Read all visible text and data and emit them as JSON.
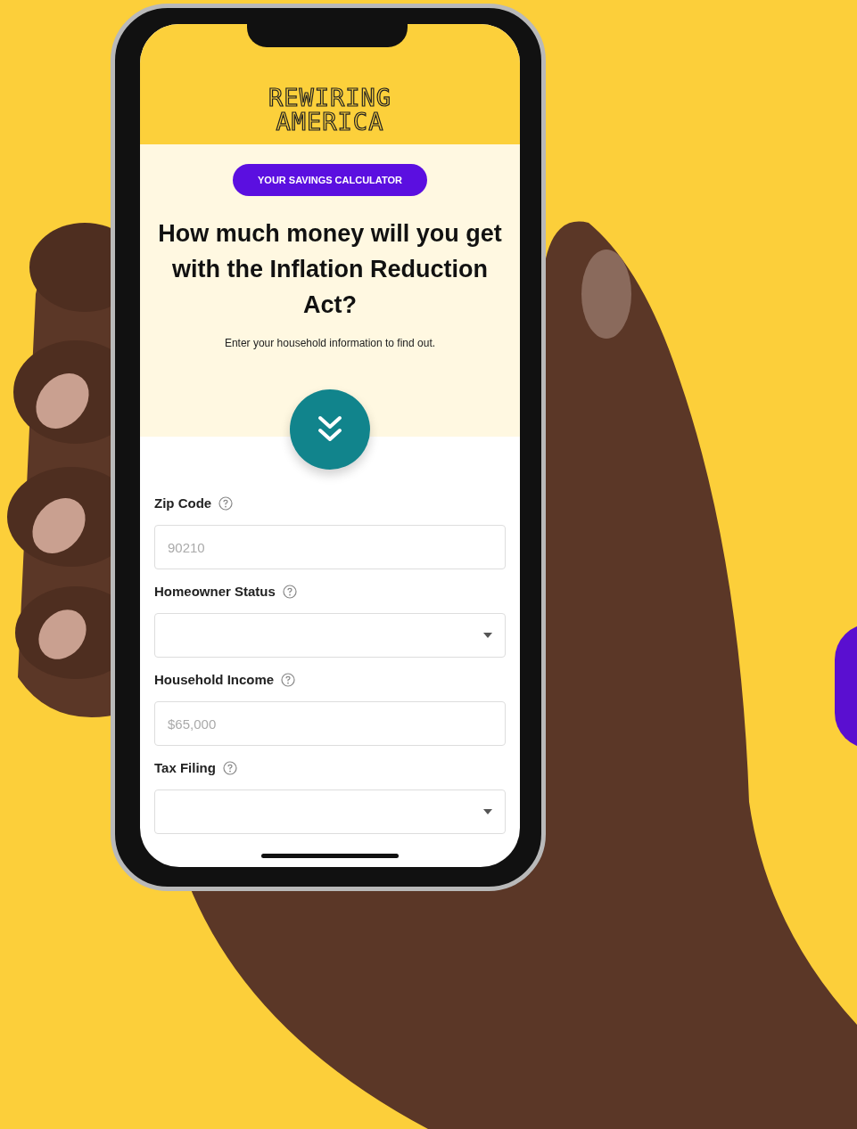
{
  "logo": {
    "line_1": "REWIRING",
    "line_2": "AMERICA"
  },
  "badge": "YOUR SAVINGS CALCULATOR",
  "heading": "How much money will you get with the Inflation Reduction Act?",
  "subheading": "Enter your household information to find out.",
  "fields": [
    {
      "label": "Zip Code",
      "kind": "text",
      "placeholder": "90210"
    },
    {
      "label": "Homeowner Status",
      "kind": "select"
    },
    {
      "label": "Household Income",
      "kind": "text",
      "placeholder": "$65,000"
    },
    {
      "label": "Tax Filing",
      "kind": "select"
    }
  ]
}
